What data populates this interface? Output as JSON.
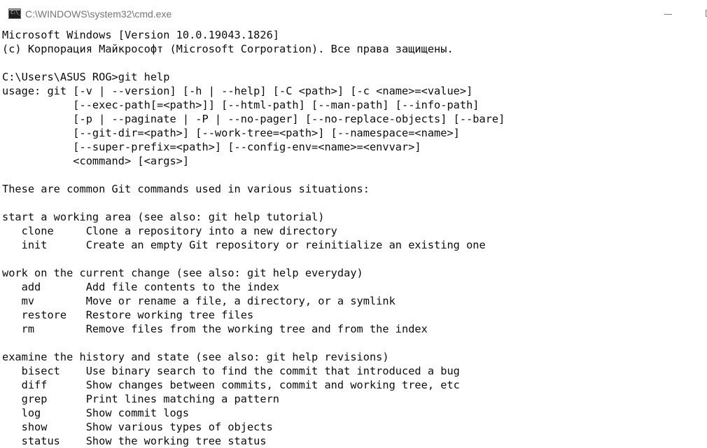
{
  "window": {
    "title": "C:\\WINDOWS\\system32\\cmd.exe",
    "icon": "cmd-prompt-icon",
    "prompt_glyph": "C:\\_"
  },
  "controls": {
    "minimize_icon": "minimize-icon",
    "maximize_icon": "maximize-icon"
  },
  "console": {
    "lines": [
      "Microsoft Windows [Version 10.0.19043.1826]",
      "(c) Корпорация Майкрософт (Microsoft Corporation). Все права защищены.",
      "",
      "C:\\Users\\ASUS ROG>git help",
      "usage: git [-v | --version] [-h | --help] [-C <path>] [-c <name>=<value>]",
      "           [--exec-path[=<path>]] [--html-path] [--man-path] [--info-path]",
      "           [-p | --paginate | -P | --no-pager] [--no-replace-objects] [--bare]",
      "           [--git-dir=<path>] [--work-tree=<path>] [--namespace=<name>]",
      "           [--super-prefix=<path>] [--config-env=<name>=<envvar>]",
      "           <command> [<args>]",
      "",
      "These are common Git commands used in various situations:",
      "",
      "start a working area (see also: git help tutorial)",
      "   clone     Clone a repository into a new directory",
      "   init      Create an empty Git repository or reinitialize an existing one",
      "",
      "work on the current change (see also: git help everyday)",
      "   add       Add file contents to the index",
      "   mv        Move or rename a file, a directory, or a symlink",
      "   restore   Restore working tree files",
      "   rm        Remove files from the working tree and from the index",
      "",
      "examine the history and state (see also: git help revisions)",
      "   bisect    Use binary search to find the commit that introduced a bug",
      "   diff      Show changes between commits, commit and working tree, etc",
      "   grep      Print lines matching a pattern",
      "   log       Show commit logs",
      "   show      Show various types of objects",
      "   status    Show the working tree status"
    ]
  }
}
